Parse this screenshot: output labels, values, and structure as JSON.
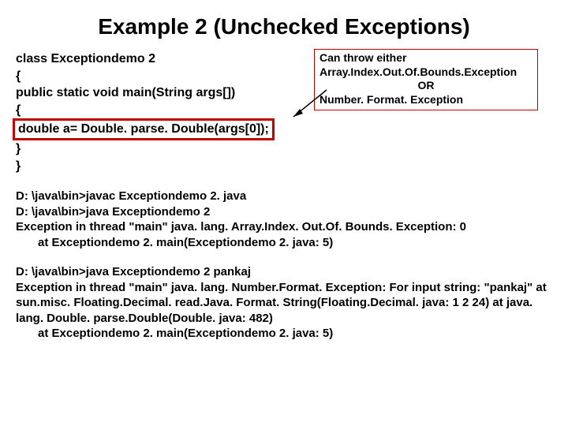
{
  "title": "Example 2 (Unchecked Exceptions)",
  "code": {
    "l1": "class Exceptiondemo 2",
    "l2": "{",
    "l3": "public static void main(String args[])",
    "l4": "{",
    "l5": "double a= Double. parse. Double(args[0]);",
    "l6": "}",
    "l7": "}"
  },
  "callout": {
    "l1": "Can throw either",
    "l2": "Array.Index.Out.Of.Bounds.Exception",
    "or": "OR",
    "l3": "Number. Format. Exception"
  },
  "out1": {
    "l1": "D: \\java\\bin>javac Exceptiondemo 2. java",
    "l2": "D: \\java\\bin>java Exceptiondemo 2",
    "l3": "Exception in thread \"main\"  java. lang. Array.Index. Out.Of. Bounds. Exception: 0",
    "l4": "at Exceptiondemo 2. main(Exceptiondemo 2. java: 5)"
  },
  "out2": {
    "l1": "D: \\java\\bin>java Exceptiondemo 2 pankaj",
    "l2": "Exception in thread \"main\" java. lang. Number.Format. Exception: For input string: \"pankaj\"    at",
    "l3": "sun.misc. Floating.Decimal. read.Java. Format. String(Floating.Decimal. java: 1 2 24)   at java. lang. Double. parse.Double(Double. java: 482)",
    "l4": "at Exceptiondemo 2. main(Exceptiondemo 2. java: 5)"
  }
}
